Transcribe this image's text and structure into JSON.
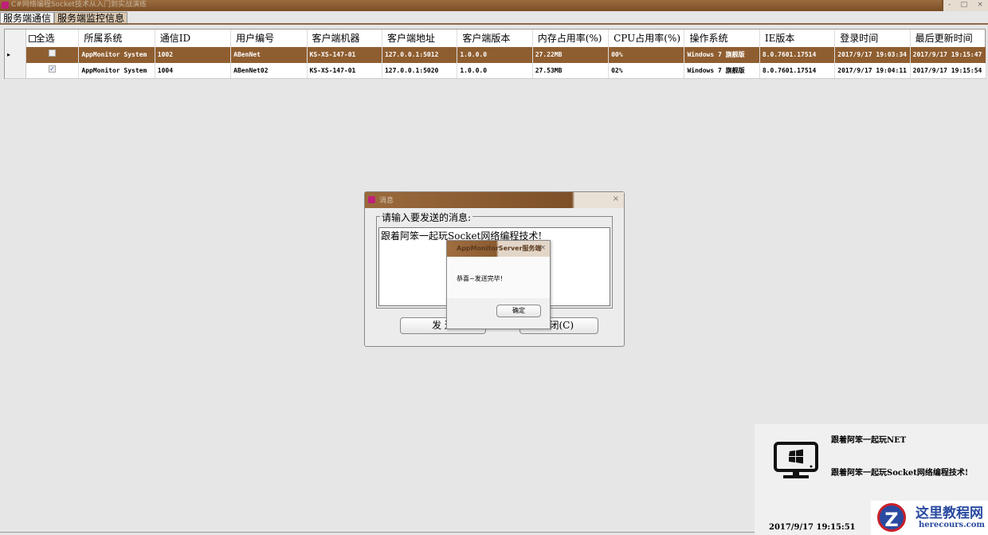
{
  "window": {
    "title": "C#网络编程Socket技术从入门到实战演练",
    "min": "-",
    "max": "□",
    "close": "×"
  },
  "tabs": [
    {
      "label": "服务端通信"
    },
    {
      "label": "服务端监控信息"
    }
  ],
  "grid": {
    "select_all": "全选",
    "columns": [
      "所属系统",
      "通信ID",
      "用户编号",
      "客户端机器",
      "客户端地址",
      "客户端版本",
      "内存占用率(%)",
      "CPU占用率(%)",
      "操作系统",
      "IE版本",
      "登录时间",
      "最后更新时间"
    ],
    "rows": [
      {
        "checked": false,
        "selected": true,
        "cells": [
          "AppMonitor System",
          "1002",
          "ABenNet",
          "KS-XS-147-01",
          "127.0.0.1:5012",
          "1.0.0.0",
          "27.22MB",
          "00%",
          "Windows 7 旗舰版",
          "8.0.7601.17514",
          "2017/9/17 19:03:34",
          "2017/9/17 19:15:47"
        ]
      },
      {
        "checked": true,
        "selected": false,
        "cells": [
          "AppMonitor System",
          "1004",
          "ABenNet02",
          "KS-XS-147-01",
          "127.0.0.1:5020",
          "1.0.0.0",
          "27.53MB",
          "02%",
          "Windows 7 旗舰版",
          "8.0.7601.17514",
          "2017/9/17 19:04:11",
          "2017/9/17 19:15:54"
        ]
      }
    ]
  },
  "send_dialog": {
    "title": "消息",
    "close": "×",
    "group_label": "请输入要发送的消息:",
    "message": "跟着阿笨一起玩Socket网络编程技术!",
    "send_label": "发 送",
    "close_label": "关闭(C)"
  },
  "message_box": {
    "title": "AppMonitorServer服务端",
    "close": "×",
    "text": "恭喜~发送完毕!",
    "ok_label": "确定"
  },
  "notification": {
    "line1": "跟着阿笨一起玩NET",
    "line2": "跟着阿笨一起玩Socket网络编程技术!",
    "time": "2017/9/17 19:15:51"
  },
  "watermark": {
    "name": "这里教程网",
    "url": "herecours.com",
    "mark": "Z"
  }
}
